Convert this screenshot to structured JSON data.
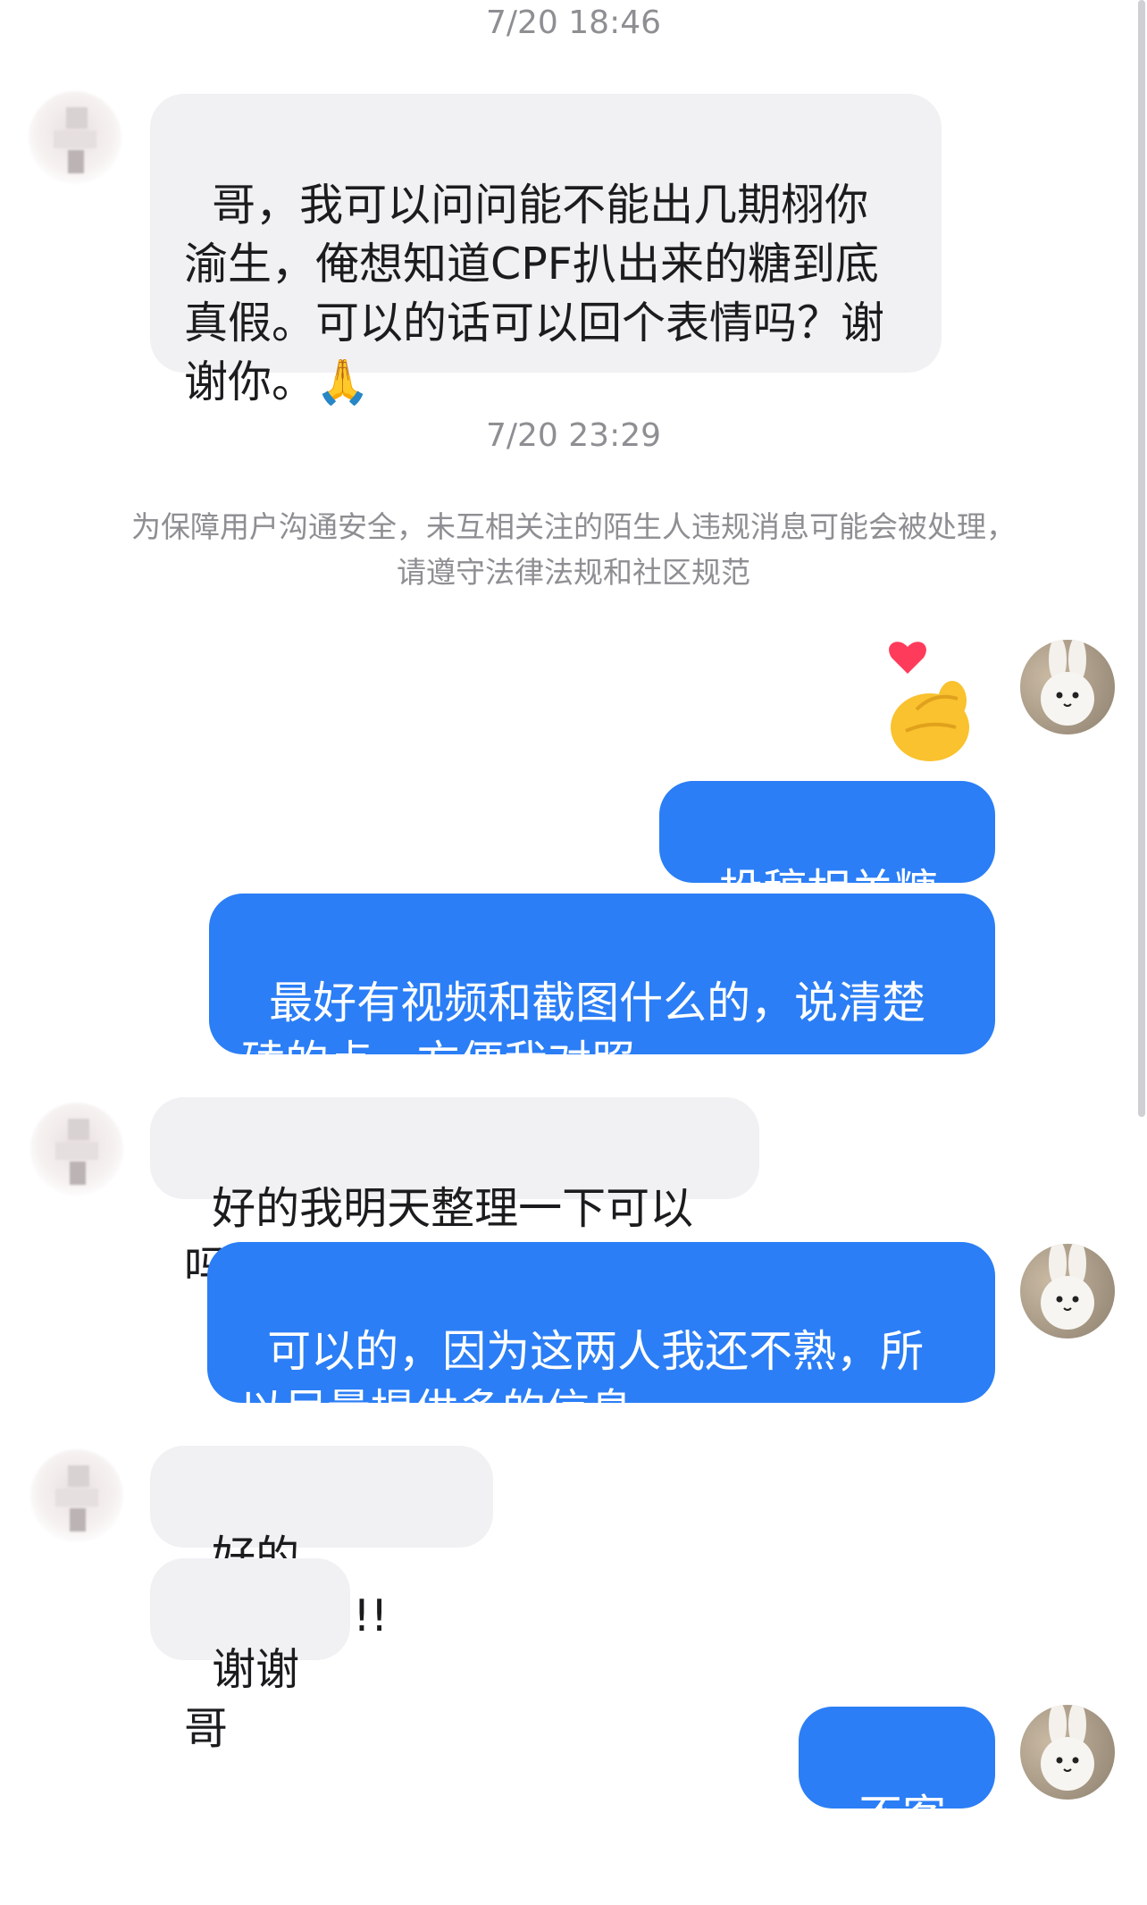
{
  "timestamps": [
    "7/20 18:46",
    "7/20 23:29"
  ],
  "notice": "为保障用户沟通安全，未互相关注的陌生人违规消息可能会被处理，请遵守法律法规和社区规范",
  "messages": [
    {
      "from": "other",
      "text": "哥，我可以问问能不能出几期栩你渝生，俺想知道CPF扒出来的糖到底真假。可以的话可以回个表情吗？谢谢你。"
    },
    {
      "from": "me",
      "sticker": "finger-heart-emoji"
    },
    {
      "from": "me",
      "text": "投稿相关糖点"
    },
    {
      "from": "me",
      "text": "最好有视频和截图什么的，说清楚磕的点，方便我对照"
    },
    {
      "from": "other",
      "text": "好的我明天整理一下可以吗"
    },
    {
      "from": "me",
      "text": "可以的，因为这两人我还不熟，所以尽量提供多的信息"
    },
    {
      "from": "other",
      "text": "好的 (ᵔᴗᵔ)ᵒᵏ!!!!"
    },
    {
      "from": "other",
      "text": "谢谢哥"
    },
    {
      "from": "me",
      "text": "不客气"
    }
  ],
  "colors": {
    "outgoing": "#2b7ef5",
    "incoming": "#f1f1f4",
    "timestamp": "#8e8e93"
  },
  "icons": {
    "praying_hands": "🙏"
  }
}
